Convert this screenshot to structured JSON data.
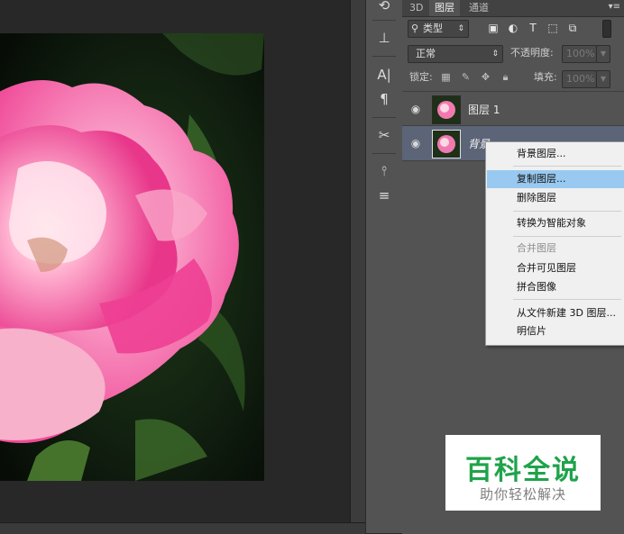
{
  "panel": {
    "tabs": [
      {
        "label": "3D"
      },
      {
        "label": "图层"
      },
      {
        "label": "通道"
      }
    ],
    "filter": {
      "kind_label": "类型"
    },
    "blend": {
      "mode": "正常",
      "opacity_label": "不透明度:",
      "opacity_value": "100%"
    },
    "lock": {
      "label": "锁定:",
      "fill_label": "填充:",
      "fill_value": "100%"
    },
    "layers": [
      {
        "name": "图层 1"
      },
      {
        "name": "背景"
      }
    ]
  },
  "context_menu": {
    "items": [
      {
        "label": "背景图层...",
        "state": "normal"
      },
      {
        "label": "复制图层...",
        "state": "highlighted"
      },
      {
        "label": "删除图层",
        "state": "normal"
      },
      {
        "label": "转换为智能对象",
        "state": "normal"
      },
      {
        "label": "合并图层",
        "state": "disabled"
      },
      {
        "label": "合并可见图层",
        "state": "normal"
      },
      {
        "label": "拼合图像",
        "state": "normal"
      },
      {
        "label": "从文件新建 3D 图层...",
        "state": "normal"
      },
      {
        "label": "明信片",
        "state": "normal"
      }
    ]
  },
  "watermark": {
    "title": "百科全说",
    "subtitle": "助你轻松解决"
  },
  "colors": {
    "panel_bg": "#535353",
    "highlight": "#99c9f0",
    "brand_green": "#1fa34a"
  },
  "icons": [
    "eye-icon",
    "search-icon",
    "image-filter-icon",
    "adjustment-filter-icon",
    "type-filter-icon",
    "shape-filter-icon",
    "smart-object-filter-icon",
    "lock-icon"
  ]
}
